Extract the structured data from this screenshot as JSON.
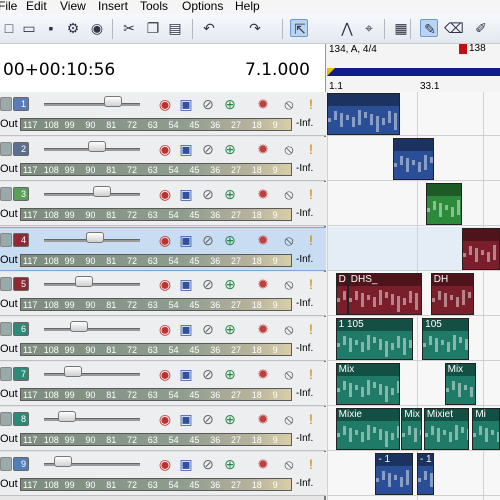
{
  "menu": [
    "File",
    "Edit",
    "View",
    "Insert",
    "Tools",
    "Options",
    "Help"
  ],
  "toolbar_icons": [
    "new-icon",
    "open-icon",
    "save-icon",
    "properties-icon",
    "render-icon",
    "cut-icon",
    "copy-icon",
    "paste-icon",
    "undo-icon",
    "redo-icon",
    "normal-edit-icon",
    "envelope-edit-icon",
    "selection-edit-icon",
    "project-media-icon",
    "pencil-icon",
    "eraser-icon",
    "paint-icon"
  ],
  "time": {
    "timecode": "00+00:10:56",
    "measure": "7.1.000"
  },
  "ruler": {
    "marker_label": "134, A, 4/4",
    "bar1": "1.1",
    "bar2": "33.1",
    "playhead_label": "138"
  },
  "track_common": {
    "out": "Out",
    "inf": "-Inf.",
    "scale": [
      "117",
      "108",
      "99",
      "90",
      "81",
      "72",
      "63",
      "54",
      "45",
      "36",
      "27",
      "18",
      "9"
    ]
  },
  "tracks": [
    {
      "num": "1",
      "color": "#5b7bb8",
      "slider": 0.72
    },
    {
      "num": "2",
      "color": "#5b6f90",
      "slider": 0.55
    },
    {
      "num": "3",
      "color": "#5aa05a",
      "slider": 0.6
    },
    {
      "num": "4",
      "color": "#8e2a36",
      "slider": 0.53,
      "selected": true
    },
    {
      "num": "5",
      "color": "#8c2a34",
      "slider": 0.42
    },
    {
      "num": "6",
      "color": "#2e8a76",
      "slider": 0.36
    },
    {
      "num": "7",
      "color": "#2e8a76",
      "slider": 0.3
    },
    {
      "num": "8",
      "color": "#2e8a76",
      "slider": 0.24
    },
    {
      "num": "9",
      "color": "#4f7fb6",
      "slider": 0.2
    }
  ],
  "clips": [
    {
      "track": 0,
      "start": 0.0,
      "end": 0.42,
      "color": "#2b4f96",
      "label": ""
    },
    {
      "track": 1,
      "start": 0.38,
      "end": 0.62,
      "color": "#2b4f96",
      "label": ""
    },
    {
      "track": 2,
      "start": 0.57,
      "end": 0.78,
      "color": "#2d8a3a",
      "label": ""
    },
    {
      "track": 3,
      "start": 0.78,
      "end": 1.0,
      "color": "#7a1e2c",
      "label": ""
    },
    {
      "track": 4,
      "start": 0.05,
      "end": 0.12,
      "color": "#7a1e2c",
      "label": "D"
    },
    {
      "track": 4,
      "start": 0.12,
      "end": 0.55,
      "color": "#7a1e2c",
      "label": "DHS_"
    },
    {
      "track": 4,
      "start": 0.6,
      "end": 0.85,
      "color": "#7a1e2c",
      "label": "DH"
    },
    {
      "track": 5,
      "start": 0.05,
      "end": 0.5,
      "color": "#207a68",
      "label": "1 105"
    },
    {
      "track": 5,
      "start": 0.55,
      "end": 0.82,
      "color": "#207a68",
      "label": "105"
    },
    {
      "track": 6,
      "start": 0.05,
      "end": 0.42,
      "color": "#207a68",
      "label": "Mix"
    },
    {
      "track": 6,
      "start": 0.68,
      "end": 0.86,
      "color": "#207a68",
      "label": "Mix"
    },
    {
      "track": 7,
      "start": 0.05,
      "end": 0.42,
      "color": "#207a68",
      "label": "Mixie"
    },
    {
      "track": 7,
      "start": 0.43,
      "end": 0.55,
      "color": "#207a68",
      "label": "Mix"
    },
    {
      "track": 7,
      "start": 0.56,
      "end": 0.82,
      "color": "#207a68",
      "label": "Mixiet"
    },
    {
      "track": 7,
      "start": 0.84,
      "end": 1.0,
      "color": "#207a68",
      "label": "Mi"
    },
    {
      "track": 8,
      "start": 0.28,
      "end": 0.5,
      "color": "#2b4f96",
      "label": "- 1"
    },
    {
      "track": 8,
      "start": 0.52,
      "end": 0.62,
      "color": "#2b4f96",
      "label": "- 1"
    }
  ]
}
